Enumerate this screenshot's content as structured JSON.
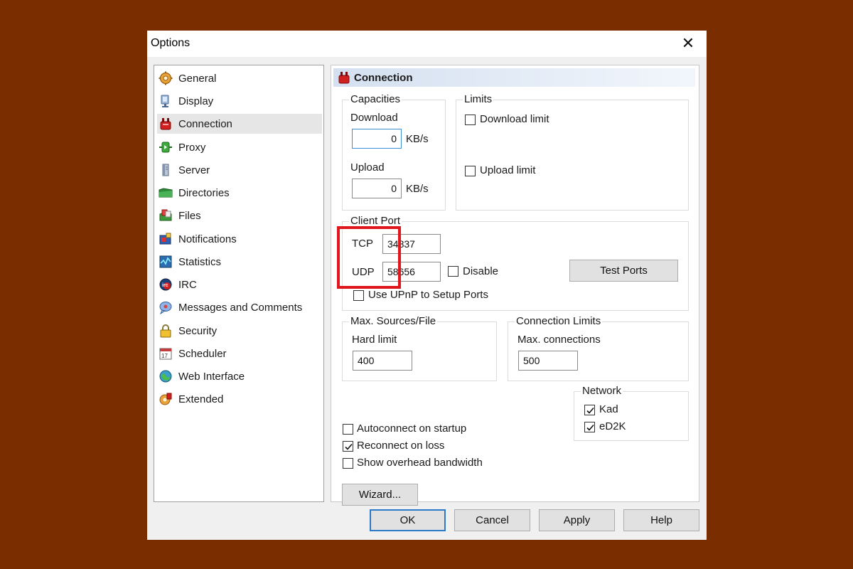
{
  "window": {
    "title": "Options",
    "close_glyph": "✕"
  },
  "nav": {
    "items": [
      {
        "label": "General",
        "icon": "gear-icon"
      },
      {
        "label": "Display",
        "icon": "monitor-icon"
      },
      {
        "label": "Connection",
        "icon": "plug-icon"
      },
      {
        "label": "Proxy",
        "icon": "proxy-icon"
      },
      {
        "label": "Server",
        "icon": "server-icon"
      },
      {
        "label": "Directories",
        "icon": "folder-icon"
      },
      {
        "label": "Files",
        "icon": "files-icon"
      },
      {
        "label": "Notifications",
        "icon": "notification-icon"
      },
      {
        "label": "Statistics",
        "icon": "statistics-icon"
      },
      {
        "label": "IRC",
        "icon": "irc-icon"
      },
      {
        "label": "Messages and Comments",
        "icon": "messages-icon"
      },
      {
        "label": "Security",
        "icon": "lock-icon"
      },
      {
        "label": "Scheduler",
        "icon": "calendar-icon"
      },
      {
        "label": "Web Interface",
        "icon": "globe-icon"
      },
      {
        "label": "Extended",
        "icon": "extended-gear-icon"
      }
    ],
    "active": "Connection"
  },
  "header": {
    "title": "Connection",
    "icon": "plug-icon"
  },
  "capacities": {
    "title": "Capacities",
    "download_label": "Download",
    "download_value": "0",
    "download_unit": "KB/s",
    "upload_label": "Upload",
    "upload_value": "0",
    "upload_unit": "KB/s"
  },
  "limits": {
    "title": "Limits",
    "download_limit_label": "Download limit",
    "download_limit_checked": false,
    "upload_limit_label": "Upload limit",
    "upload_limit_checked": false
  },
  "client_port": {
    "title": "Client Port",
    "tcp_label": "TCP",
    "tcp_value": "34837",
    "udp_label": "UDP",
    "udp_value": "58656",
    "disable_label": "Disable",
    "disable_checked": false,
    "test_ports_label": "Test Ports",
    "upnp_label": "Use UPnP to Setup Ports",
    "upnp_checked": false
  },
  "max_sources": {
    "title": "Max. Sources/File",
    "hard_limit_label": "Hard limit",
    "hard_limit_value": "400"
  },
  "connection_limits": {
    "title": "Connection Limits",
    "max_connections_label": "Max. connections",
    "max_connections_value": "500"
  },
  "options": {
    "autoconnect_label": "Autoconnect on startup",
    "autoconnect_checked": false,
    "reconnect_label": "Reconnect on loss",
    "reconnect_checked": true,
    "overhead_label": "Show overhead bandwidth",
    "overhead_checked": false
  },
  "network": {
    "title": "Network",
    "kad_label": "Kad",
    "kad_checked": true,
    "ed2k_label": "eD2K",
    "ed2k_checked": true
  },
  "wizard_label": "Wizard...",
  "footer": {
    "ok_label": "OK",
    "cancel_label": "Cancel",
    "apply_label": "Apply",
    "help_label": "Help"
  },
  "colors": {
    "background": "#7a2e00",
    "highlight": "#e0161d",
    "accent": "#2b79c7"
  }
}
